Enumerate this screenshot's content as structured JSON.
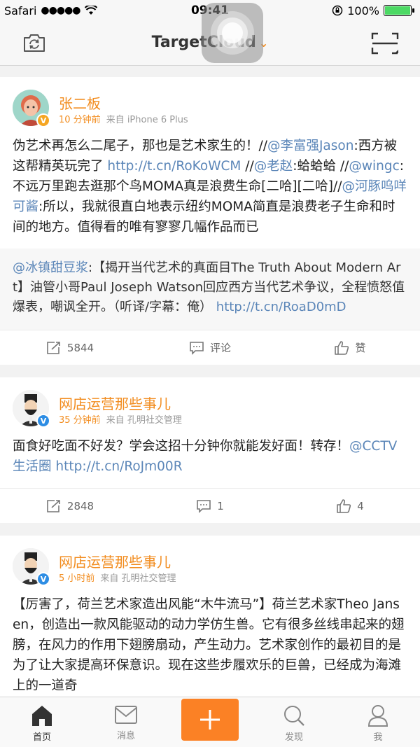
{
  "status_bar": {
    "carrier": "Safari",
    "signal": "●●●●●",
    "time": "09:41",
    "battery": "100%",
    "battery_level": 1.0
  },
  "nav": {
    "title": "TargetCloud",
    "caret": "⌄",
    "left_icon": "camera-refresh-icon",
    "right_icon": "scan-icon"
  },
  "posts": [
    {
      "author": "张二板",
      "time": "10 分钟前",
      "source": "来自 iPhone 6 Plus",
      "verified_color": "#f5a623",
      "body": [
        {
          "t": "伪艺术再怎么二尾子，那也是艺术家生的！//"
        },
        {
          "t": "@李富强Jason",
          "link": true
        },
        {
          "t": ":西方被这帮精英玩完了 "
        },
        {
          "t": "http://t.cn/RoKoWCM",
          "link": true
        },
        {
          "t": " //"
        },
        {
          "t": "@老赵",
          "link": true
        },
        {
          "t": ":蛤蛤蛤 //"
        },
        {
          "t": "@wingc",
          "link": true
        },
        {
          "t": ": 不远万里跑去逛那个鸟MOMA真是浪费生命[二哈][二哈]//"
        },
        {
          "t": "@河豚呜咩可酱",
          "link": true
        },
        {
          "t": ":所以，我就很直白地表示纽约MOMA简直是浪费老子生命和时间的地方。值得看的唯有寥寥几幅作品而已"
        }
      ],
      "repost": [
        {
          "t": "@冰镇甜豆浆",
          "link": true
        },
        {
          "t": ":【揭开当代艺术的真面目The Truth About Modern Art】油管小哥Paul Joseph Watson回应西方当代艺术争议，全程愤怒值爆表，嘲讽全开。（听译/字幕：俺） "
        },
        {
          "t": "http://t.cn/RoaD0mD",
          "link": true
        }
      ],
      "reposts": "5844",
      "comments": "评论",
      "likes": "赞"
    },
    {
      "author": "网店运营那些事儿",
      "time": "35 分钟前",
      "source": "来自 孔明社交管理",
      "verified_color": "#2d8de4",
      "body": [
        {
          "t": "面食好吃面不好发？学会这招十分钟你就能发好面！转存！"
        },
        {
          "t": "@CCTV生活圈",
          "link": true
        },
        {
          "t": " "
        },
        {
          "t": "http://t.cn/RoJm00R",
          "link": true
        }
      ],
      "reposts": "2848",
      "comments": "1",
      "likes": "4"
    },
    {
      "author": "网店运营那些事儿",
      "time": "5 小时前",
      "source": "来自 孔明社交管理",
      "verified_color": "#2d8de4",
      "body": [
        {
          "t": "【厉害了，荷兰艺术家造出风能“木牛流马”】荷兰艺术家Theo Jansen，创造出一款风能驱动的动力学仿生兽。它有很多丝线串起来的翅膀，在风力的作用下翅膀扇动，产生动力。艺术家创作的最初目的是为了让大家提高环保意识。现在这些步履欢乐的巨兽，已经成为海滩上的一道奇"
        }
      ]
    }
  ],
  "tabs": [
    {
      "label": "首页",
      "icon": "home-icon",
      "active": true
    },
    {
      "label": "消息",
      "icon": "message-icon"
    },
    {
      "label": "",
      "icon": "plus-icon"
    },
    {
      "label": "发现",
      "icon": "discover-icon"
    },
    {
      "label": "我",
      "icon": "profile-icon"
    }
  ],
  "colors": {
    "accent": "#f28c1e",
    "link": "#5b86b8",
    "plus_button": "#fb8125"
  }
}
